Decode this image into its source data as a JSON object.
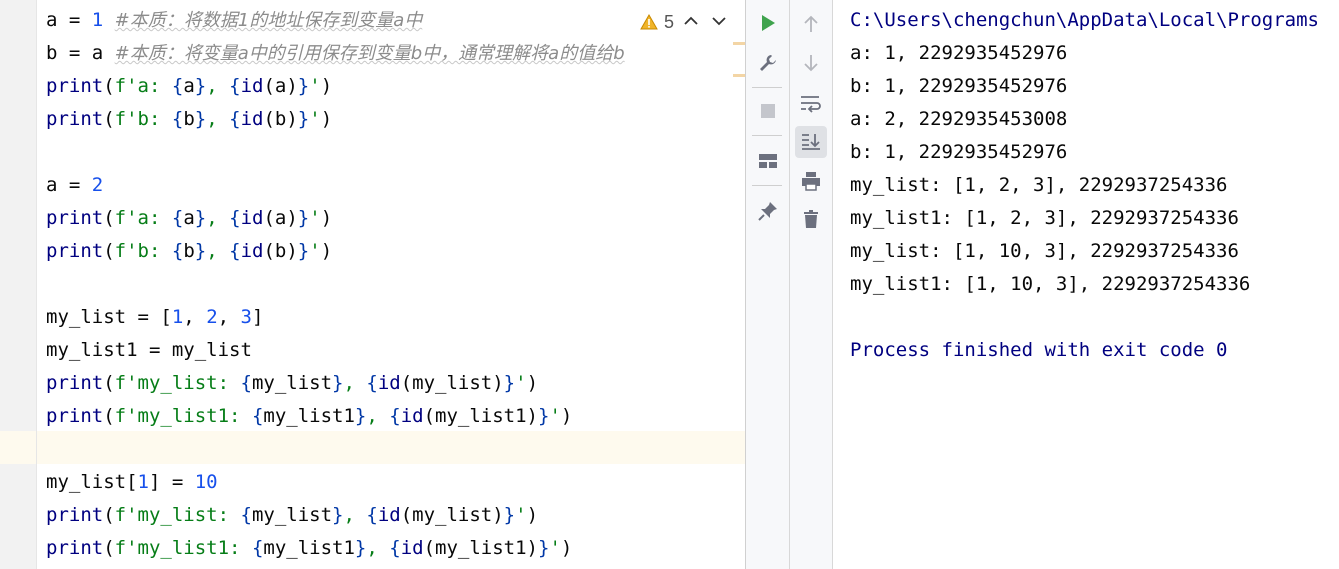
{
  "editor": {
    "inspection": {
      "count": "5",
      "warning_icon": "warning-triangle-icon"
    },
    "lines": [
      {
        "tokens": [
          [
            "plain",
            "a = "
          ],
          [
            "num",
            "1"
          ],
          [
            "plain",
            " "
          ],
          [
            "cmt",
            "#本质：将数据1的地址保存到变量a中"
          ]
        ]
      },
      {
        "tokens": [
          [
            "plain",
            "b = a "
          ],
          [
            "cmt",
            "#本质：将变量a中的引用保存到变量b中，通常理解将a的值给b"
          ]
        ]
      },
      {
        "tokens": [
          [
            "fn",
            "print"
          ],
          [
            "plain",
            "("
          ],
          [
            "str",
            "f'a: "
          ],
          [
            "brace",
            "{"
          ],
          [
            "plain",
            "a"
          ],
          [
            "brace",
            "}"
          ],
          [
            "str",
            ", "
          ],
          [
            "brace",
            "{"
          ],
          [
            "fn",
            "id"
          ],
          [
            "plain",
            "(a)"
          ],
          [
            "brace",
            "}"
          ],
          [
            "str",
            "'"
          ],
          [
            "plain",
            ")"
          ]
        ]
      },
      {
        "tokens": [
          [
            "fn",
            "print"
          ],
          [
            "plain",
            "("
          ],
          [
            "str",
            "f'b: "
          ],
          [
            "brace",
            "{"
          ],
          [
            "plain",
            "b"
          ],
          [
            "brace",
            "}"
          ],
          [
            "str",
            ", "
          ],
          [
            "brace",
            "{"
          ],
          [
            "fn",
            "id"
          ],
          [
            "plain",
            "(b)"
          ],
          [
            "brace",
            "}"
          ],
          [
            "str",
            "'"
          ],
          [
            "plain",
            ")"
          ]
        ]
      },
      {
        "tokens": []
      },
      {
        "tokens": [
          [
            "plain",
            "a = "
          ],
          [
            "num",
            "2"
          ]
        ]
      },
      {
        "tokens": [
          [
            "fn",
            "print"
          ],
          [
            "plain",
            "("
          ],
          [
            "str",
            "f'a: "
          ],
          [
            "brace",
            "{"
          ],
          [
            "plain",
            "a"
          ],
          [
            "brace",
            "}"
          ],
          [
            "str",
            ", "
          ],
          [
            "brace",
            "{"
          ],
          [
            "fn",
            "id"
          ],
          [
            "plain",
            "(a)"
          ],
          [
            "brace",
            "}"
          ],
          [
            "str",
            "'"
          ],
          [
            "plain",
            ")"
          ]
        ]
      },
      {
        "tokens": [
          [
            "fn",
            "print"
          ],
          [
            "plain",
            "("
          ],
          [
            "str",
            "f'b: "
          ],
          [
            "brace",
            "{"
          ],
          [
            "plain",
            "b"
          ],
          [
            "brace",
            "}"
          ],
          [
            "str",
            ", "
          ],
          [
            "brace",
            "{"
          ],
          [
            "fn",
            "id"
          ],
          [
            "plain",
            "(b)"
          ],
          [
            "brace",
            "}"
          ],
          [
            "str",
            "'"
          ],
          [
            "plain",
            ")"
          ]
        ]
      },
      {
        "tokens": []
      },
      {
        "tokens": [
          [
            "plain",
            "my_list = ["
          ],
          [
            "num",
            "1"
          ],
          [
            "plain",
            ", "
          ],
          [
            "num",
            "2"
          ],
          [
            "plain",
            ", "
          ],
          [
            "num",
            "3"
          ],
          [
            "plain",
            "]"
          ]
        ]
      },
      {
        "tokens": [
          [
            "plain",
            "my_list1 = my_list"
          ]
        ]
      },
      {
        "tokens": [
          [
            "fn",
            "print"
          ],
          [
            "plain",
            "("
          ],
          [
            "str",
            "f'my_list: "
          ],
          [
            "brace",
            "{"
          ],
          [
            "plain",
            "my_list"
          ],
          [
            "brace",
            "}"
          ],
          [
            "str",
            ", "
          ],
          [
            "brace",
            "{"
          ],
          [
            "fn",
            "id"
          ],
          [
            "plain",
            "(my_list)"
          ],
          [
            "brace",
            "}"
          ],
          [
            "str",
            "'"
          ],
          [
            "plain",
            ")"
          ]
        ]
      },
      {
        "tokens": [
          [
            "fn",
            "print"
          ],
          [
            "plain",
            "("
          ],
          [
            "str",
            "f'my_list1: "
          ],
          [
            "brace",
            "{"
          ],
          [
            "plain",
            "my_list1"
          ],
          [
            "brace",
            "}"
          ],
          [
            "str",
            ", "
          ],
          [
            "brace",
            "{"
          ],
          [
            "fn",
            "id"
          ],
          [
            "plain",
            "(my_list1)"
          ],
          [
            "brace",
            "}"
          ],
          [
            "str",
            "'"
          ],
          [
            "plain",
            ")"
          ]
        ]
      },
      {
        "tokens": []
      },
      {
        "tokens": [
          [
            "plain",
            "my_list["
          ],
          [
            "num",
            "1"
          ],
          [
            "plain",
            "] = "
          ],
          [
            "num",
            "10"
          ]
        ]
      },
      {
        "tokens": [
          [
            "fn",
            "print"
          ],
          [
            "plain",
            "("
          ],
          [
            "str",
            "f'my_list: "
          ],
          [
            "brace",
            "{"
          ],
          [
            "plain",
            "my_list"
          ],
          [
            "brace",
            "}"
          ],
          [
            "str",
            ", "
          ],
          [
            "brace",
            "{"
          ],
          [
            "fn",
            "id"
          ],
          [
            "plain",
            "(my_list)"
          ],
          [
            "brace",
            "}"
          ],
          [
            "str",
            "'"
          ],
          [
            "plain",
            ")"
          ]
        ]
      },
      {
        "tokens": [
          [
            "fn",
            "print"
          ],
          [
            "plain",
            "("
          ],
          [
            "str",
            "f'my_list1: "
          ],
          [
            "brace",
            "{"
          ],
          [
            "plain",
            "my_list1"
          ],
          [
            "brace",
            "}"
          ],
          [
            "str",
            ", "
          ],
          [
            "brace",
            "{"
          ],
          [
            "fn",
            "id"
          ],
          [
            "plain",
            "(my_list1)"
          ],
          [
            "brace",
            "}"
          ],
          [
            "str",
            "'"
          ],
          [
            "plain",
            ")"
          ]
        ]
      }
    ]
  },
  "run_toolbar": {
    "left": [
      "run-icon",
      "wrench-icon",
      "stop-icon",
      "layout-icon",
      "pin-icon"
    ],
    "right": [
      "up-arrow-icon",
      "down-arrow-icon",
      "soft-wrap-icon",
      "scroll-to-end-icon",
      "print-icon",
      "trash-icon"
    ]
  },
  "console": {
    "lines": [
      {
        "text": "C:\\Users\\chengchun\\AppData\\Local\\Programs",
        "kind": "path"
      },
      {
        "text": "a: 1, 2292935452976",
        "kind": "out"
      },
      {
        "text": "b: 1, 2292935452976",
        "kind": "out"
      },
      {
        "text": "a: 2, 2292935453008",
        "kind": "out"
      },
      {
        "text": "b: 1, 2292935452976",
        "kind": "out"
      },
      {
        "text": "my_list: [1, 2, 3], 2292937254336",
        "kind": "out"
      },
      {
        "text": "my_list1: [1, 2, 3], 2292937254336",
        "kind": "out"
      },
      {
        "text": "my_list: [1, 10, 3], 2292937254336",
        "kind": "out"
      },
      {
        "text": "my_list1: [1, 10, 3], 2292937254336",
        "kind": "out"
      },
      {
        "text": "",
        "kind": "out"
      },
      {
        "text": "Process finished with exit code 0",
        "kind": "finish"
      }
    ]
  }
}
